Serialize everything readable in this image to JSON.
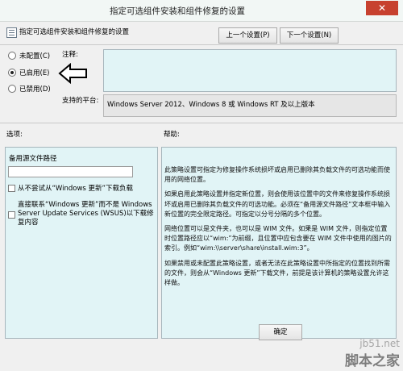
{
  "window": {
    "title": "指定可选组件安装和组件修复的设置",
    "close_symbol": "✕"
  },
  "header": {
    "setting_name": "指定可选组件安装和组件修复的设置",
    "prev_button": "上一个设置(P)",
    "next_button": "下一个设置(N)"
  },
  "radios": [
    {
      "label": "未配置(C)",
      "checked": false
    },
    {
      "label": "已启用(E)",
      "checked": true
    },
    {
      "label": "已禁用(D)",
      "checked": false
    }
  ],
  "comment": {
    "label": "注释:",
    "value": ""
  },
  "platform": {
    "label": "支持的平台:",
    "value": "Windows Server 2012、Windows 8 或 Windows RT 及以上版本"
  },
  "sections": {
    "options_label": "选项:",
    "help_label": "帮助:"
  },
  "options": {
    "path_label": "备用源文件路径",
    "path_value": "",
    "check1_label": "从不尝试从“Windows 更新”下载负载",
    "check2_label": "直接联系“Windows 更新”而不是 Windows Server Update Services (WSUS)以下载修复内容"
  },
  "help": [
    "此策略设置可指定为修复操作系统损坏或启用已删除其负载文件的可选功能而使用的网络位置。",
    "如果启用此策略设置并指定新位置，则会使用该位置中的文件来修复操作系统损坏或启用已删除其负载文件的可选功能。必须在“备用源文件路径”文本框中输入新位置的完全限定路径。可指定以分号分隔的多个位置。",
    "网络位置可以是文件夹，也可以是 WIM 文件。如果是 WIM 文件，则指定位置时位置路径应以“wim:”为前缀，且位置中应包含要在 WIM 文件中使用的图片的索引。例如“wim:\\\\server\\share\\install.wim:3”。",
    "如果禁用或未配置此策略设置，或者无法在此策略设置中所指定的位置找到所需的文件，则会从“Windows 更新”下载文件，前提是该计算机的策略设置允许这样做。"
  ],
  "footer": {
    "ok_button": "确定"
  },
  "watermark": {
    "site": "jb51.net",
    "brand": "脚本之家"
  },
  "colors": {
    "panel_bg": "#e1f4f6",
    "close_red": "#c7412f"
  }
}
